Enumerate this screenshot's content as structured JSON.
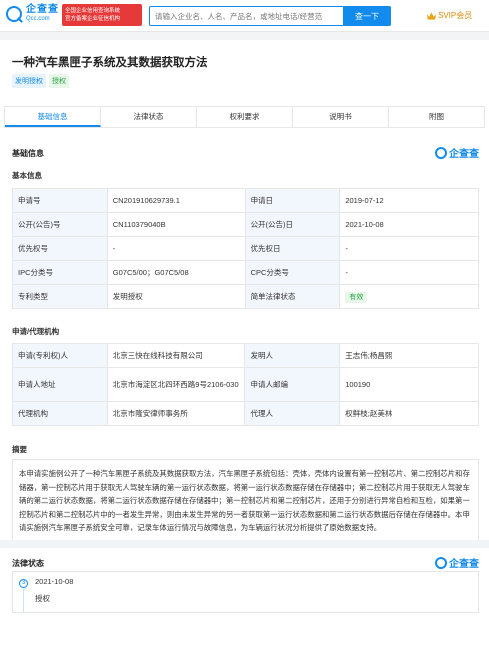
{
  "header": {
    "logo_cn": "企查查",
    "logo_en": "Qcc.com",
    "gov_badge_line1": "全国企业信用查询系统",
    "gov_badge_line2": "官方备案企业征信机构",
    "search_placeholder": "请输入企业名、人名、产品名，或地址电话/经营范",
    "search_button": "查一下",
    "svip_label": "SVIP会员"
  },
  "patent": {
    "title": "一种汽车黑匣子系统及其数据获取方法",
    "tags": [
      "发明授权",
      "授权"
    ]
  },
  "tabs": [
    "基础信息",
    "法律状态",
    "权利要求",
    "说明书",
    "附图"
  ],
  "active_tab": "基础信息",
  "brand": "企查查",
  "basic": {
    "section_title": "基础信息",
    "sub_title": "基本信息",
    "rows": [
      {
        "l1": "申请号",
        "v1": "CN201910629739.1",
        "l2": "申请日",
        "v2": "2019-07-12"
      },
      {
        "l1": "公开(公告)号",
        "v1": "CN110379040B",
        "l2": "公开(公告)日",
        "v2": "2021-10-08"
      },
      {
        "l1": "优先权号",
        "v1": "-",
        "l2": "优先权日",
        "v2": "-"
      },
      {
        "l1": "IPC分类号",
        "v1": "G07C5/00；G07C5/08",
        "l2": "CPC分类号",
        "v2": "-"
      },
      {
        "l1": "专利类型",
        "v1": "发明授权",
        "l2": "简单法律状态",
        "v2": "有效"
      }
    ]
  },
  "agency": {
    "sub_title": "申请/代理机构",
    "rows": [
      {
        "l1": "申请(专利权)人",
        "v1": "北京三快在线科技有限公司",
        "l2": "发明人",
        "v2": "王志伟;杨昌熙"
      },
      {
        "l1": "申请人地址",
        "v1": "北京市海淀区北四环西路9号2106-030",
        "l2": "申请人邮编",
        "v2": "100190"
      },
      {
        "l1": "代理机构",
        "v1": "北京市隆安律师事务所",
        "l2": "代理人",
        "v2": "权鲜枝;赵美林"
      }
    ]
  },
  "abstract": {
    "title": "摘要",
    "text": "本申请实施例公开了一种汽车黑匣子系统及其数据获取方法，汽车黑匣子系统包括：壳体，壳体内设置有第一控制芯片、第二控制芯片和存储器，第一控制芯片用于获取无人驾驶车辆的第一运行状态数据，将第一运行状态数据存储在存储器中；第二控制芯片用于获取无人驾驶车辆的第二运行状态数据，将第二运行状态数据存储在存储器中；第一控制芯片和第二控制芯片，还用于分别进行异常自检和互检，如果第一控制芯片和第二控制芯片中的一者发生异常，则由未发生异常的另一者获取第一运行状态数据和第二运行状态数据后存储在存储器中。本申请实施例汽车黑匣子系统安全可靠，记录车体运行情况与故障信息，为车辆运行状况分析提供了原始数据支持。"
  },
  "legal": {
    "title": "法律状态",
    "events": [
      {
        "index": "3",
        "date": "2021-10-08",
        "status": "授权"
      }
    ]
  }
}
